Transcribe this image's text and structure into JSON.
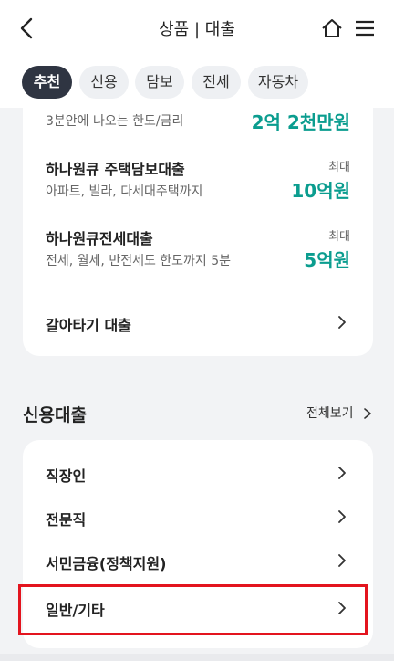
{
  "header": {
    "title": "상품 | 대출",
    "back_icon": "chevron-left-icon",
    "home_icon": "home-icon",
    "menu_icon": "hamburger-menu-icon"
  },
  "tabs": [
    {
      "label": "추천",
      "active": true
    },
    {
      "label": "신용",
      "active": false
    },
    {
      "label": "담보",
      "active": false
    },
    {
      "label": "전세",
      "active": false
    },
    {
      "label": "자동차",
      "active": false
    }
  ],
  "top_card": {
    "partial_row": {
      "desc": "3분안에 나오는 한도/금리",
      "amount": "2억 2천만원"
    },
    "loans": [
      {
        "name": "하나원큐 주택담보대출",
        "desc": "아파트, 빌라, 다세대주택까지",
        "max_label": "최대",
        "amount": "10억원"
      },
      {
        "name": "하나원큐전세대출",
        "desc": "전세, 월세, 반전세도 한도까지 5분",
        "max_label": "최대",
        "amount": "5억원"
      }
    ],
    "link_row": {
      "label": "갈아타기 대출"
    }
  },
  "credit_section": {
    "title": "신용대출",
    "view_all": "전체보기",
    "items": [
      {
        "label": "직장인"
      },
      {
        "label": "전문직"
      },
      {
        "label": "서민금융(정책지원)"
      },
      {
        "label": "일반/기타"
      }
    ]
  },
  "colors": {
    "accent": "#0b9d8f",
    "tab_active": "#2f3542",
    "highlight": "#e3141e"
  }
}
